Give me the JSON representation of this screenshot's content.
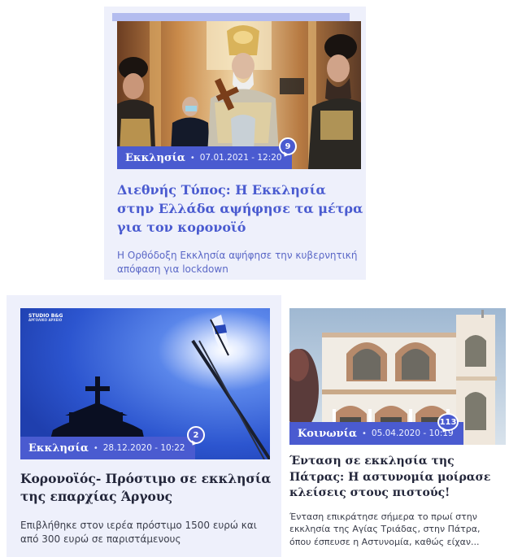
{
  "articles": [
    {
      "category": "Εκκλησία",
      "separator": "•",
      "date": "07.01.2021 - 12:20",
      "comments": "9",
      "title": "Διεθνής Τύπος: Η Εκκλησία στην Ελλάδα αψήφησε τα μέτρα για τον κορονοϊό",
      "excerpt": "Η Ορθόδοξη Εκκλησία αψήφησε την κυβερνητική απόφαση για lockdown"
    },
    {
      "category": "Εκκλησία",
      "separator": "•",
      "date": "28.12.2020 - 10:22",
      "comments": "2",
      "watermark_line1": "STUDIO B&G",
      "watermark_line2": "ΑΡΓΟΛΙΚΟ ΑΡΧΕΙΟ",
      "title": "Κορονοϊός- Πρόστιμο σε εκκλησία της επαρχίας Άργους",
      "excerpt": "Επιβλήθηκε στον ιερέα πρόστιμο 1500 ευρώ και από 300 ευρώ σε παριστάμενους"
    },
    {
      "category": "Κοινωνία",
      "separator": "•",
      "date": "05.04.2020 - 10:19",
      "comments": "113",
      "title": "Ένταση σε εκκλησία της Πάτρας: Η αστυνομία μοίρασε κλείσεις στους πιστούς!",
      "excerpt": "Ένταση επικράτησε σήμερα το πρωί στην εκκλησία της Αγίας Τριάδας, στην Πάτρα, όπου έσπευσε η Αστυνομία, καθώς είχαν..."
    }
  ],
  "colors": {
    "accent": "#4a5bd0",
    "title": "#4a5bd0",
    "title_dark": "#23263a",
    "excerpt": "#5b68c7",
    "excerpt_dark": "#3a3d4a",
    "card_bg": "#eef0fb"
  }
}
